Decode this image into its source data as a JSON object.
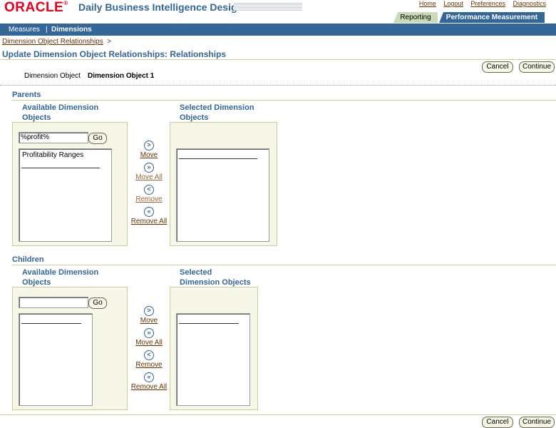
{
  "header": {
    "brand": "ORACLE",
    "app_title": "Daily Business Intelligence Designer",
    "global_links": [
      "Home",
      "Logout",
      "Preferences",
      "Diagnostics"
    ],
    "tabs": [
      "Reporting",
      "Performance Measurement"
    ],
    "nav": {
      "measures": "Measures",
      "separator": "|",
      "dimensions": "Dimensions"
    }
  },
  "breadcrumb": {
    "link": "Dimension Object Relationships",
    "sep": ">"
  },
  "page_title": "Update Dimension Object Relationships: Relationships",
  "buttons": {
    "cancel": "Cancel",
    "continue": "Continue",
    "go": "Go"
  },
  "dimension_object": {
    "label": "Dimension Object",
    "value": "Dimension Object 1"
  },
  "parents": {
    "title": "Parents",
    "available_head": [
      "Available Dimension",
      "Objects"
    ],
    "selected_head": [
      "Selected Dimension",
      "Objects"
    ],
    "search_value": "%profit%",
    "available_items": [
      "Profitability Ranges"
    ]
  },
  "children": {
    "title": "Children",
    "available_head": [
      "Available Dimension",
      "Objects"
    ],
    "selected_head": [
      "Selected",
      "Dimension Objects"
    ],
    "search_value": ""
  },
  "shuttle": {
    "move": "Move",
    "move_all": "Move All",
    "remove": "Remove",
    "remove_all": "Remove All",
    "icons": {
      "move": ">",
      "move_all": "»",
      "remove": "<",
      "remove_all": "«"
    }
  }
}
